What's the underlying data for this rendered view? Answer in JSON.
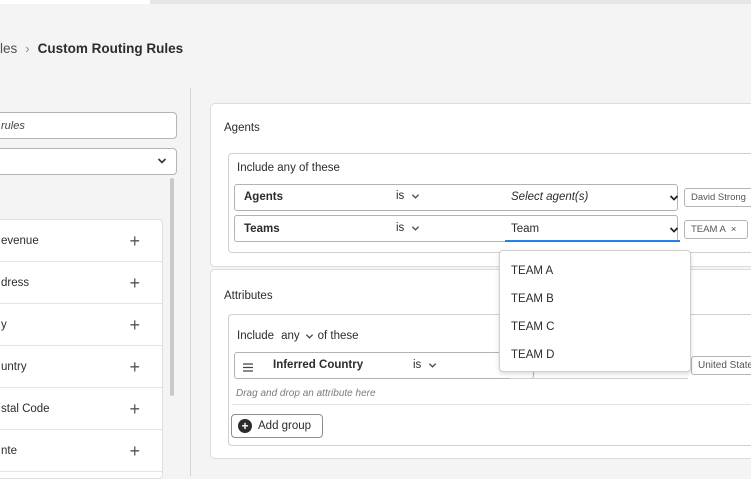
{
  "breadcrumb": {
    "parent": "les",
    "separator": "›",
    "current": "Custom Routing Rules"
  },
  "left_panel": {
    "search_value": "rules",
    "items": [
      {
        "label": "evenue"
      },
      {
        "label": "dress"
      },
      {
        "label": "y"
      },
      {
        "label": "untry"
      },
      {
        "label": "stal Code"
      },
      {
        "label": "nte"
      }
    ]
  },
  "agents_section": {
    "title": "Agents",
    "include_label": "Include any of these",
    "rows": [
      {
        "field": "Agents",
        "operator": "is",
        "value": "Select agent(s)",
        "token": "David Strong"
      },
      {
        "field": "Teams",
        "operator": "is",
        "value": "Team",
        "token": "TEAM A",
        "token_remove": "×"
      }
    ],
    "dropdown_options": [
      "TEAM A",
      "TEAM B",
      "TEAM C",
      "TEAM D"
    ]
  },
  "attributes_section": {
    "title": "Attributes",
    "include_prefix": "Include",
    "include_mode": "any",
    "include_suffix": "of these",
    "row": {
      "field": "Inferred Country",
      "operator": "is",
      "token": "United State"
    },
    "drop_hint": "Drag and drop an attribute here",
    "add_group_label": "Add group"
  },
  "colors": {
    "accent_underline": "#2680eb",
    "page_bg": "#f4f4f4",
    "card_bg": "#ffffff"
  }
}
